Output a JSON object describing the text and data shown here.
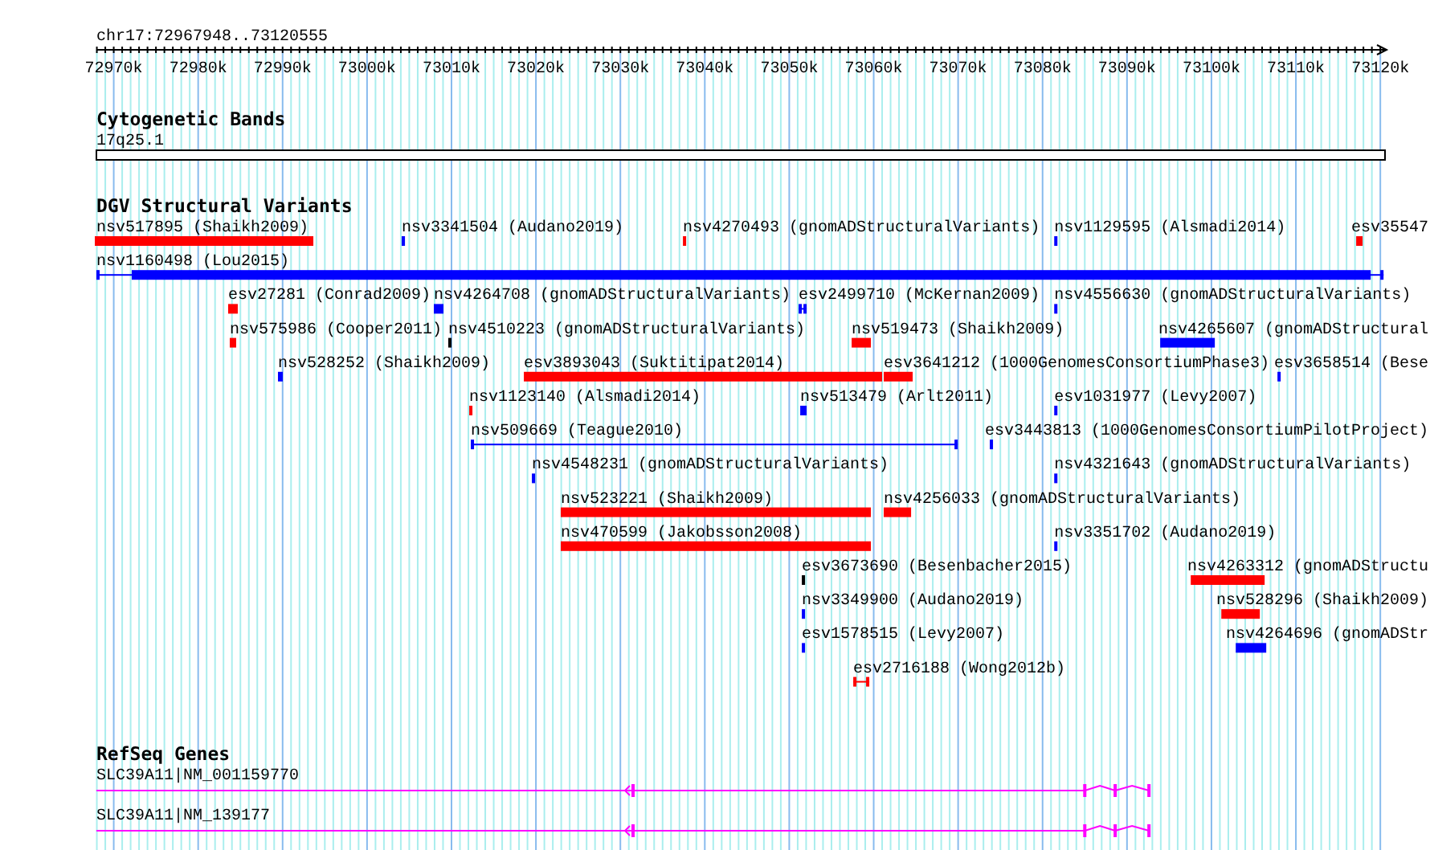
{
  "ruler": {
    "title": "chr17:72967948..73120555",
    "ticks": [
      "72970k",
      "72980k",
      "72990k",
      "73000k",
      "73010k",
      "73020k",
      "73030k",
      "73040k",
      "73050k",
      "73060k",
      "73070k",
      "73080k",
      "73090k",
      "73100k",
      "73110k",
      "73120k"
    ]
  },
  "cytoband_track": {
    "title": "Cytogenetic Bands",
    "band": "17q25.1"
  },
  "dgv_track": {
    "title": "DGV Structural Variants",
    "rows": [
      [
        {
          "label": "nsv517895 (Shaikh2009)",
          "kind": "block",
          "color": "#ff0000"
        },
        {
          "label": "nsv3341504 (Audano2019)",
          "kind": "block",
          "color": "#0000ff"
        },
        {
          "label": "nsv4270493 (gnomADStructuralVariants)",
          "kind": "block",
          "color": "#ff0000"
        },
        {
          "label": "nsv1129595 (Alsmadi2014)",
          "kind": "block",
          "color": "#0000ff"
        },
        {
          "label": "esv35547",
          "kind": "block",
          "color": "#ff0000"
        }
      ],
      [
        {
          "label": "nsv1160498 (Lou2015)",
          "kind": "partial",
          "color": "#0000ff"
        }
      ],
      [
        {
          "label": "esv27281 (Conrad2009)",
          "kind": "block",
          "color": "#ff0000"
        },
        {
          "label": "nsv4264708 (gnomADStructuralVariants)",
          "kind": "block",
          "color": "#0000ff"
        },
        {
          "label": "esv2499710 (McKernan2009)",
          "kind": "interval",
          "color": "#0000ff"
        },
        {
          "label": "nsv4556630 (gnomADStructuralVariants)",
          "kind": "block",
          "color": "#0000ff"
        }
      ],
      [
        {
          "label": "nsv575986 (Cooper2011)",
          "kind": "block",
          "color": "#ff0000"
        },
        {
          "label": "nsv4510223 (gnomADStructuralVariants)",
          "kind": "block",
          "color": "#000000"
        },
        {
          "label": "nsv519473 (Shaikh2009)",
          "kind": "block",
          "color": "#ff0000"
        },
        {
          "label": "nsv4265607 (gnomADStructural",
          "kind": "block",
          "color": "#0000ff"
        }
      ],
      [
        {
          "label": "nsv528252 (Shaikh2009)",
          "kind": "block",
          "color": "#0000ff"
        },
        {
          "label": "esv3893043 (Suktitipat2014)",
          "kind": "block",
          "color": "#ff0000"
        },
        {
          "label": "esv3641212 (1000GenomesConsortiumPhase3)",
          "kind": "block",
          "color": "#ff0000"
        },
        {
          "label": "esv3658514 (Bese",
          "kind": "block",
          "color": "#0000ff"
        }
      ],
      [
        {
          "label": "nsv1123140 (Alsmadi2014)",
          "kind": "block",
          "color": "#ff0000"
        },
        {
          "label": "nsv513479 (Arlt2011)",
          "kind": "block",
          "color": "#0000ff"
        },
        {
          "label": "esv1031977 (Levy2007)",
          "kind": "block",
          "color": "#0000ff"
        }
      ],
      [
        {
          "label": "nsv509669 (Teague2010)",
          "kind": "interval",
          "color": "#0000ff"
        },
        {
          "label": "esv3443813 (1000GenomesConsortiumPilotProject)",
          "kind": "block",
          "color": "#0000ff"
        }
      ],
      [
        {
          "label": "nsv4548231 (gnomADStructuralVariants)",
          "kind": "block",
          "color": "#0000ff"
        },
        {
          "label": "nsv4321643 (gnomADStructuralVariants)",
          "kind": "block",
          "color": "#0000ff"
        }
      ],
      [
        {
          "label": "nsv523221 (Shaikh2009)",
          "kind": "block",
          "color": "#ff0000"
        },
        {
          "label": "nsv4256033 (gnomADStructuralVariants)",
          "kind": "block",
          "color": "#ff0000"
        }
      ],
      [
        {
          "label": "nsv470599 (Jakobsson2008)",
          "kind": "block",
          "color": "#ff0000"
        },
        {
          "label": "nsv3351702 (Audano2019)",
          "kind": "block",
          "color": "#0000ff"
        }
      ],
      [
        {
          "label": "esv3673690 (Besenbacher2015)",
          "kind": "block",
          "color": "#000000"
        },
        {
          "label": "nsv4263312 (gnomADStructu",
          "kind": "block",
          "color": "#ff0000"
        }
      ],
      [
        {
          "label": "nsv3349900 (Audano2019)",
          "kind": "block",
          "color": "#0000ff"
        },
        {
          "label": "nsv528296 (Shaikh2009)",
          "kind": "block",
          "color": "#ff0000"
        }
      ],
      [
        {
          "label": "esv1578515 (Levy2007)",
          "kind": "block",
          "color": "#0000ff"
        },
        {
          "label": "nsv4264696 (gnomADStr",
          "kind": "block",
          "color": "#0000ff"
        }
      ],
      [
        {
          "label": "esv2716188 (Wong2012b)",
          "kind": "interval",
          "color": "#ff0000"
        }
      ]
    ]
  },
  "refseq_track": {
    "title": "RefSeq Genes",
    "transcripts": [
      {
        "label": "SLC39A11|NM_001159770"
      },
      {
        "label": "SLC39A11|NM_139177"
      }
    ]
  }
}
